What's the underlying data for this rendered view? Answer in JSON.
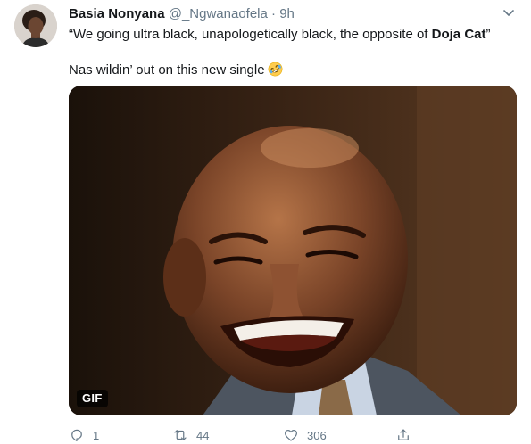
{
  "tweet": {
    "author_name": "Basia Nonyana",
    "handle": "@_Ngwanaofela",
    "separator": "·",
    "time": "9h",
    "line1_before": "“We going ultra black, unapologetically black, the opposite of ",
    "line1_bold": "Doja Cat",
    "line1_after": "”",
    "line2": "Nas wildin’ out on this new single",
    "emoji": "rolling-on-floor-laughing",
    "media_badge": "GIF",
    "reply_count": "1",
    "retweet_count": "44",
    "like_count": "306"
  },
  "icons": {
    "caret": "chevron-down-icon",
    "reply": "reply-icon",
    "retweet": "retweet-icon",
    "like": "heart-icon",
    "share": "share-icon"
  },
  "colors": {
    "text": "#14171a",
    "secondary": "#657786"
  }
}
